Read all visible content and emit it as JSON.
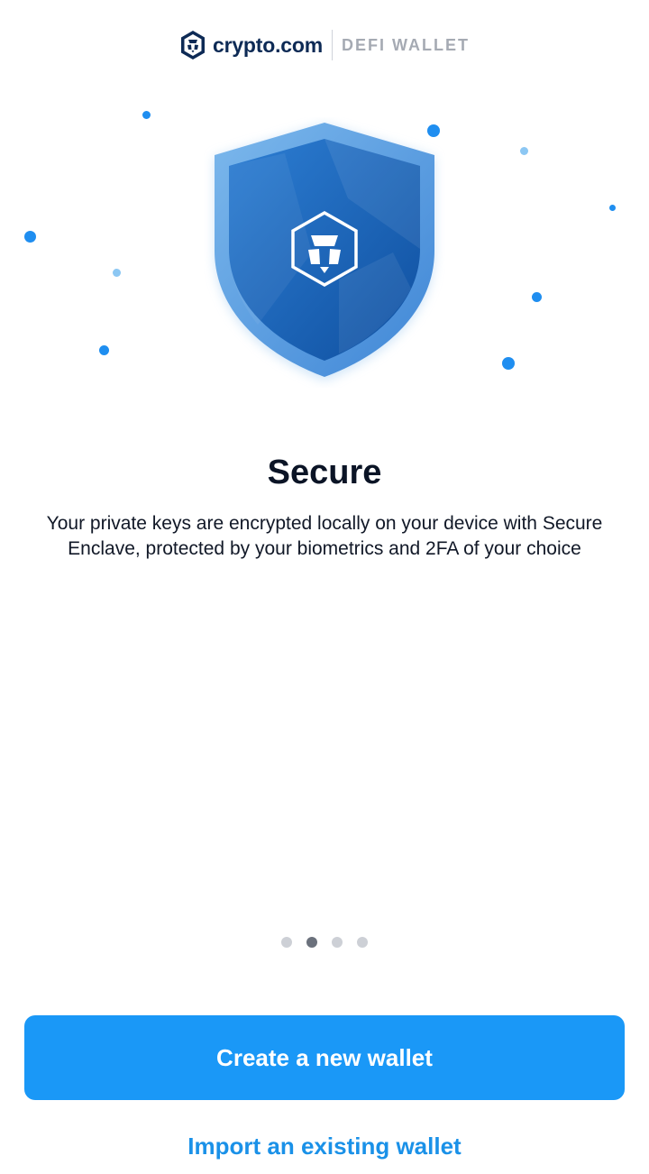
{
  "header": {
    "logo_icon": "crypto-com-lion-icon",
    "brand_name": "crypto.com",
    "brand_sub": "DEFI WALLET"
  },
  "hero": {
    "illustration": "shield-icon",
    "emblem": "crypto-com-lion-icon",
    "accent_color": "#1f8ef0"
  },
  "onboarding": {
    "title": "Secure",
    "description": "Your private keys are encrypted locally on your device with Secure Enclave, protected by your biometrics and 2FA of your choice",
    "page_count": 4,
    "active_page": 2
  },
  "actions": {
    "primary_label": "Create a new wallet",
    "primary_color": "#1a98f7",
    "secondary_label": "Import an existing wallet",
    "secondary_color": "#1a91e8"
  }
}
